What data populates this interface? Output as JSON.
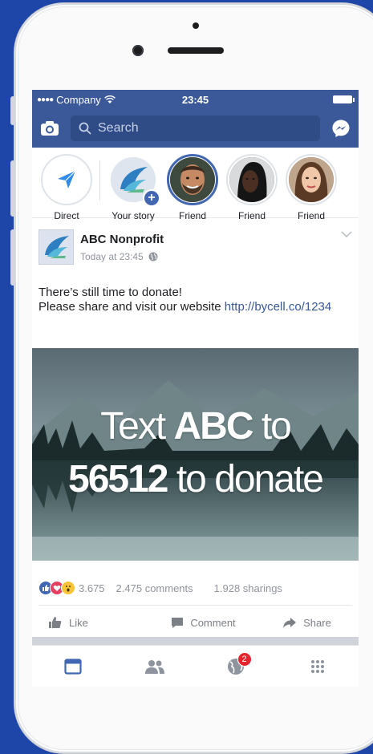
{
  "status": {
    "carrier": "Company",
    "time": "23:45"
  },
  "search": {
    "placeholder": "Search"
  },
  "stories": [
    {
      "label": "Direct"
    },
    {
      "label": "Your story"
    },
    {
      "label": "Friend"
    },
    {
      "label": "Friend"
    },
    {
      "label": "Friend"
    }
  ],
  "post": {
    "page_name": "ABC Nonprofit",
    "time": "Today at 23:45",
    "text_line1": "There’s still time to donate!",
    "text_line2_prefix": "Please share and visit our website ",
    "link": "http://bycell.co/1234",
    "image": {
      "line1_a": "Text ",
      "line1_b": "ABC",
      "line1_c": " to",
      "line2_a": "56512",
      "line2_b": " to donate"
    },
    "reactions_count": "3.675",
    "comments": "2.475 comments",
    "sharings": "1.928 sharings"
  },
  "actions": {
    "like": "Like",
    "comment": "Comment",
    "share": "Share"
  },
  "tabs": {
    "notifications_badge": "2"
  },
  "colors": {
    "brand": "#3b5998",
    "accent": "#4267b2",
    "badge": "#e4252d",
    "background": "#1e45a8"
  },
  "icons": [
    "camera-icon",
    "search-icon",
    "messenger-icon",
    "send-icon",
    "plus-icon",
    "globe-icon",
    "chevron-down-icon",
    "like-icon",
    "comment-icon",
    "share-icon",
    "feed-icon",
    "friends-icon",
    "notifications-globe-icon",
    "menu-grid-icon"
  ]
}
